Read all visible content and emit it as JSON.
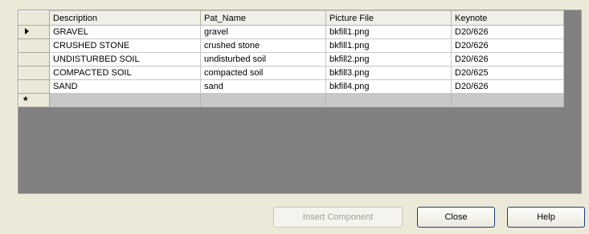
{
  "grid": {
    "columns": [
      "Description",
      "Pat_Name",
      "Picture File",
      "Keynote"
    ],
    "rows": [
      {
        "description": "GRAVEL",
        "pat_name": "gravel",
        "picture_file": "bkfill1.png",
        "keynote": "D20/626"
      },
      {
        "description": "CRUSHED STONE",
        "pat_name": "crushed stone",
        "picture_file": "bkfill1.png",
        "keynote": "D20/626"
      },
      {
        "description": "UNDISTURBED SOIL",
        "pat_name": "undisturbed soil",
        "picture_file": "bkfill2.png",
        "keynote": "D20/626"
      },
      {
        "description": "COMPACTED SOIL",
        "pat_name": "compacted soil",
        "picture_file": "bkfill3.png",
        "keynote": "D20/625"
      },
      {
        "description": "SAND",
        "pat_name": "sand",
        "picture_file": "bkfill4.png",
        "keynote": "D20/626"
      }
    ],
    "new_row_marker": "*"
  },
  "buttons": {
    "insert_component": "Insert Component",
    "close": "Close",
    "help": "Help"
  }
}
